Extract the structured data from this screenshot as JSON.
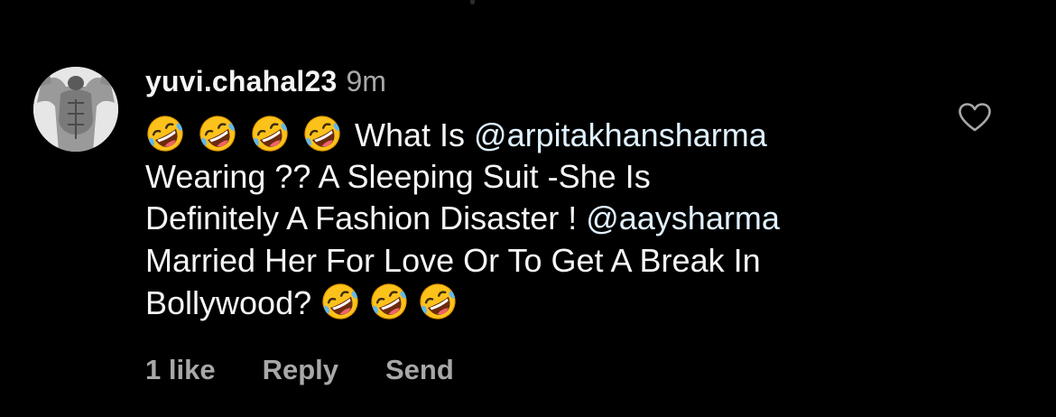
{
  "comment": {
    "username": "yuvi.chahal23",
    "time": "9m",
    "lines": [
      {
        "before": "What Is ",
        "mention": "@arpitakhansharma",
        "after": ""
      },
      {
        "text": "Wearing ?? A Sleeping Suit -She Is"
      },
      {
        "before": "Definitely A Fashion Disaster ! ",
        "mention": "@aaysharma",
        "after": ""
      },
      {
        "text": "Married Her For Love Or To Get A Break In"
      },
      {
        "text": "Bollywood? "
      }
    ],
    "leading_emoji": [
      "rolling-on-floor-laughing-emoji",
      "rolling-on-floor-laughing-emoji",
      "rolling-on-floor-laughing-emoji",
      "rolling-on-floor-laughing-emoji"
    ],
    "trailing_emoji": [
      "rolling-on-floor-laughing-emoji",
      "rolling-on-floor-laughing-emoji",
      "rolling-on-floor-laughing-emoji"
    ]
  },
  "actions": {
    "likes": "1 like",
    "reply": "Reply",
    "send": "Send"
  },
  "icons": {
    "like": "heart-outline-icon"
  },
  "colors": {
    "background": "#000000",
    "primary_text": "#f5f5f5",
    "secondary_text": "#a8a8a8",
    "mention": "#e0f1ff"
  }
}
